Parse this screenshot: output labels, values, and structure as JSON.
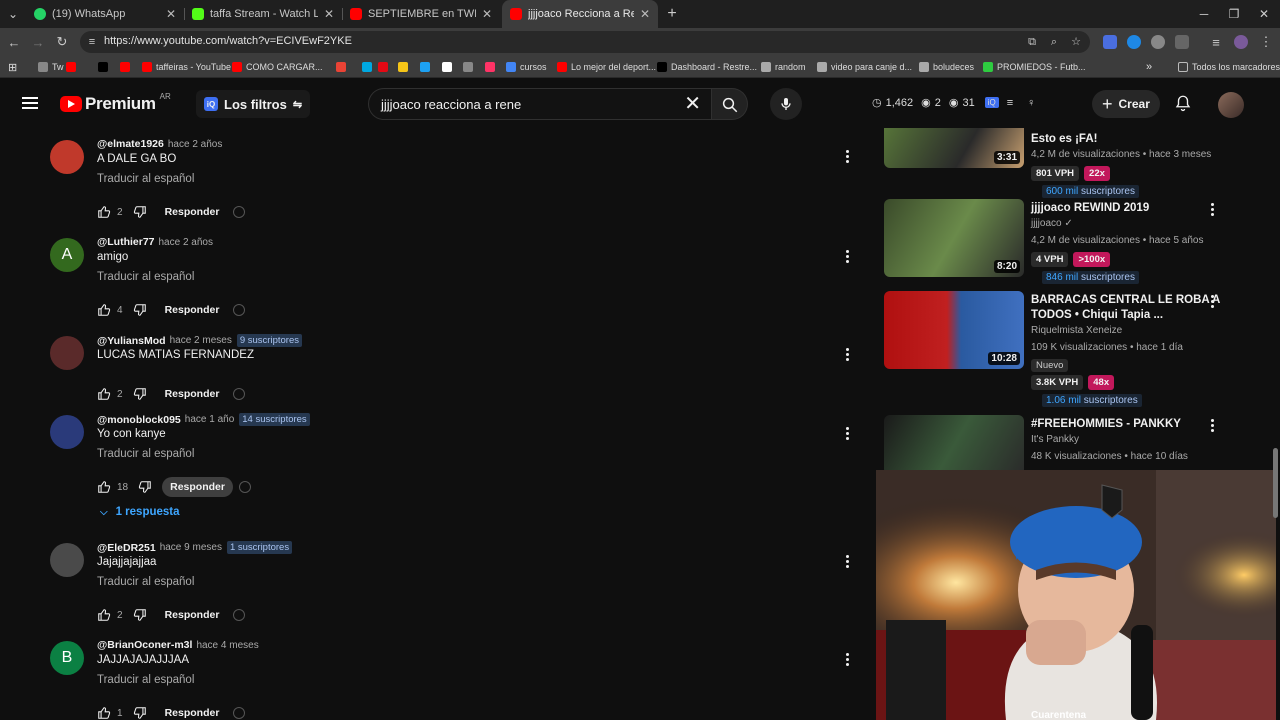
{
  "browser": {
    "tabs": [
      {
        "title": "(19) WhatsApp",
        "color": "#25d366"
      },
      {
        "title": "taffa Stream - Watch Live o",
        "color": "#53fc18"
      },
      {
        "title": "SEPTIEMBRE en TWITCH y KICK",
        "color": "#ff0000"
      },
      {
        "title": "jjjjoaco Recciona a Residente -",
        "color": "#ff0000"
      }
    ],
    "url": "https://www.youtube.com/watch?v=ECIVEwF2YKE",
    "bookmarks": [
      {
        "label": "Tw",
        "color": "#888888"
      },
      {
        "label": "",
        "color": "#ff0000"
      },
      {
        "label": "",
        "color": "#000000"
      },
      {
        "label": "",
        "color": "#ff0000"
      },
      {
        "label": "taffeiras - YouTube",
        "color": "#ff0000"
      },
      {
        "label": "COMO CARGAR...",
        "color": "#ff0000"
      },
      {
        "label": "",
        "color": "#ea4335"
      },
      {
        "label": "",
        "color": "#00a8e1"
      },
      {
        "label": "",
        "color": "#e50914"
      },
      {
        "label": "",
        "color": "#f5c518"
      },
      {
        "label": "",
        "color": "#1da1f2"
      },
      {
        "label": "",
        "color": "#ffffff"
      },
      {
        "label": "",
        "color": "#888888"
      },
      {
        "label": "",
        "color": "#ff3366"
      },
      {
        "label": "cursos",
        "color": "#4285f4"
      },
      {
        "label": "Lo mejor del deport...",
        "color": "#ff0000"
      },
      {
        "label": "Dashboard - Restre...",
        "color": "#000000"
      },
      {
        "label": "random",
        "color": "#aaaaaa"
      },
      {
        "label": "video para canje d...",
        "color": "#aaaaaa"
      },
      {
        "label": "boludeces",
        "color": "#aaaaaa"
      },
      {
        "label": "PROMIEDOS - Futb...",
        "color": "#2ecc40"
      }
    ],
    "bookmarks_all": "Todos los marcadores"
  },
  "youtube": {
    "logo": "Premium",
    "region": "AR",
    "filters": "Los filtros",
    "search_query": "jjjjoaco reacciona a rene",
    "stats": [
      "1,462",
      "2",
      "31"
    ],
    "create": "Crear"
  },
  "comments": [
    {
      "handle": "@elmate1926",
      "time": "hace 2 años",
      "subs": "",
      "text": "A DALE GA BO",
      "translate": "Traducir al español",
      "likes": "2",
      "reply": "Responder",
      "replies": "",
      "avatar_letter": "",
      "avatar_color": "#c0392b"
    },
    {
      "handle": "@Luthier77",
      "time": "hace 2 años",
      "subs": "",
      "text": "amigo",
      "translate": "Traducir al español",
      "likes": "4",
      "reply": "Responder",
      "replies": "",
      "avatar_letter": "A",
      "avatar_color": "#33691e"
    },
    {
      "handle": "@YuliansMod",
      "time": "hace 2 meses",
      "subs": "9 suscriptores",
      "text": "LUCAS MATIAS FERNANDEZ",
      "translate": "",
      "likes": "2",
      "reply": "Responder",
      "replies": "",
      "avatar_letter": "",
      "avatar_color": "#5a2a2a"
    },
    {
      "handle": "@monoblock095",
      "time": "hace 1 año",
      "subs": "14 suscriptores",
      "text": "Yo con kanye",
      "translate": "Traducir al español",
      "likes": "18",
      "reply": "Responder",
      "replies": "1 respuesta",
      "avatar_letter": "",
      "avatar_color": "#2a3a7a"
    },
    {
      "handle": "@EleDR251",
      "time": "hace 9 meses",
      "subs": "1 suscriptores",
      "text": "Jajajjajajjaa",
      "translate": "Traducir al español",
      "likes": "2",
      "reply": "Responder",
      "replies": "",
      "avatar_letter": "",
      "avatar_color": "#4a4a4a"
    },
    {
      "handle": "@BrianOconer-m3l",
      "time": "hace 4 meses",
      "subs": "",
      "text": "JAJJAJAJAJJJAA",
      "translate": "Traducir al español",
      "likes": "1",
      "reply": "Responder",
      "replies": "",
      "avatar_letter": "B",
      "avatar_color": "#0b8043"
    }
  ],
  "recommendations": [
    {
      "title": "Esto es ¡FA!",
      "channel": "",
      "meta": "4,2 M de visualizaciones • hace 3 meses",
      "duration": "3:31",
      "vph": "801 VPH",
      "mult": "22x",
      "subs_num": "600 mil",
      "subs_label": "suscriptores",
      "is_new": ""
    },
    {
      "title": "jjjjoaco REWIND 2019",
      "channel": "jjjjoaco ✓",
      "meta": "4,2 M de visualizaciones • hace 5 años",
      "duration": "8:20",
      "vph": "4 VPH",
      "mult": ">100x",
      "subs_num": "846 mil",
      "subs_label": "suscriptores",
      "is_new": ""
    },
    {
      "title": "BARRACAS CENTRAL LE ROBA A TODOS • Chiqui Tapia ...",
      "channel": "Riquelmista Xeneize",
      "meta": "109 K visualizaciones • hace 1 día",
      "duration": "10:28",
      "vph": "3.8K VPH",
      "mult": "48x",
      "subs_num": "1.06 mil",
      "subs_label": "suscriptores",
      "is_new": "Nuevo"
    },
    {
      "title": "#FREEHOMMIES - PANKKY",
      "channel": "It's Pankky",
      "meta": "48 K visualizaciones • hace 10 días",
      "duration": "",
      "vph": "",
      "mult": "",
      "subs_num": "",
      "subs_label": "",
      "is_new": ""
    }
  ],
  "webcam_caption": "Cuarentena"
}
